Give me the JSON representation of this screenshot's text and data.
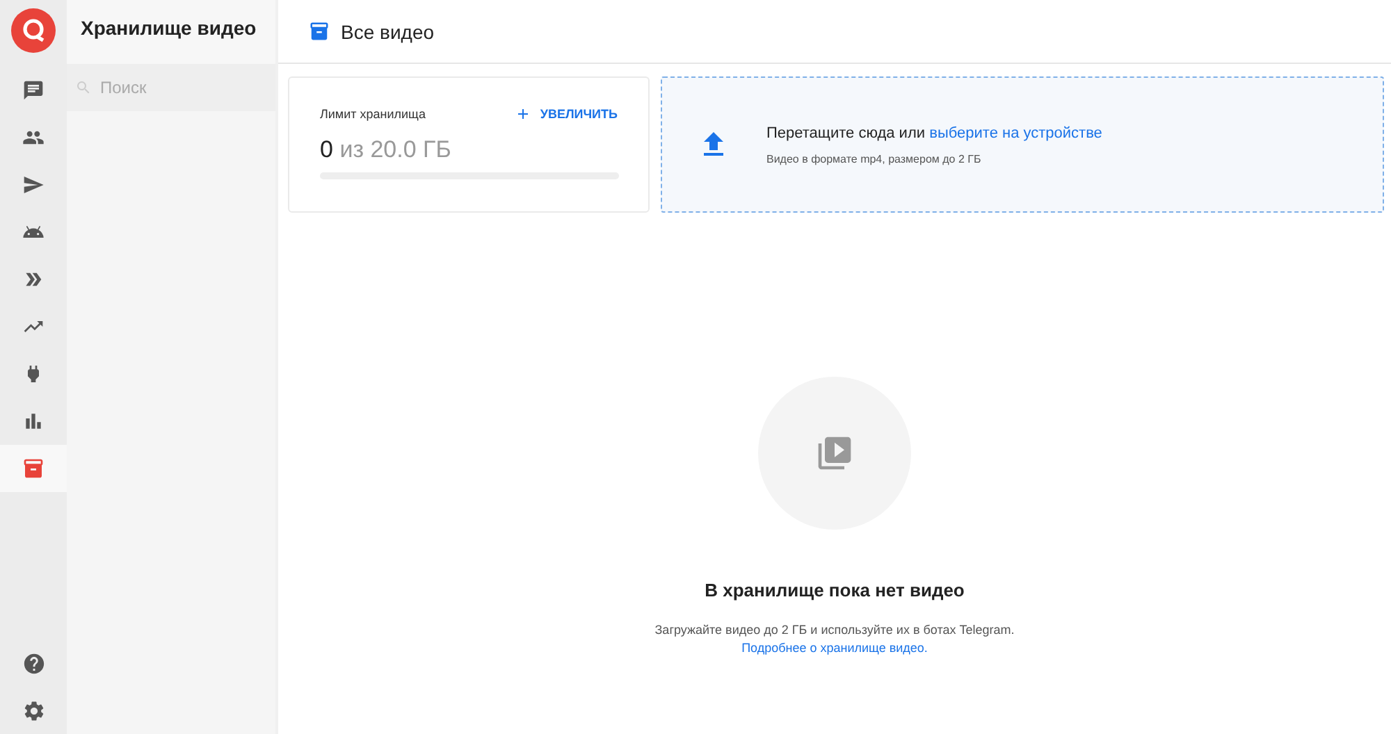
{
  "rail": {
    "items": [
      {
        "kind": "chat",
        "selected": false
      },
      {
        "kind": "people",
        "selected": false
      },
      {
        "kind": "send",
        "selected": false
      },
      {
        "kind": "bot",
        "selected": false
      },
      {
        "kind": "forward",
        "selected": false
      },
      {
        "kind": "trend",
        "selected": false
      },
      {
        "kind": "plug",
        "selected": false
      },
      {
        "kind": "chart",
        "selected": false
      },
      {
        "kind": "storage",
        "selected": true
      }
    ],
    "bottom": [
      {
        "kind": "help"
      },
      {
        "kind": "settings"
      }
    ]
  },
  "sidebar": {
    "title": "Хранилище видео",
    "search": {
      "placeholder": "Поиск"
    }
  },
  "header": {
    "title": "Все видео"
  },
  "storage_card": {
    "label": "Лимит хранилища",
    "action": "УВЕЛИЧИТЬ",
    "used": "0",
    "total": "из 20.0 ГБ",
    "level": 0
  },
  "upload": {
    "text": "Перетащите сюда или",
    "link": "выберите на устройстве",
    "hint": "Видео в формате mp4, размером до 2 ГБ"
  },
  "empty": {
    "title": "В хранилище пока нет видео",
    "text": "Загружайте видео до 2 ГБ и используйте их в ботах Telegram.",
    "link": "Подробнее о хранилище видео."
  }
}
